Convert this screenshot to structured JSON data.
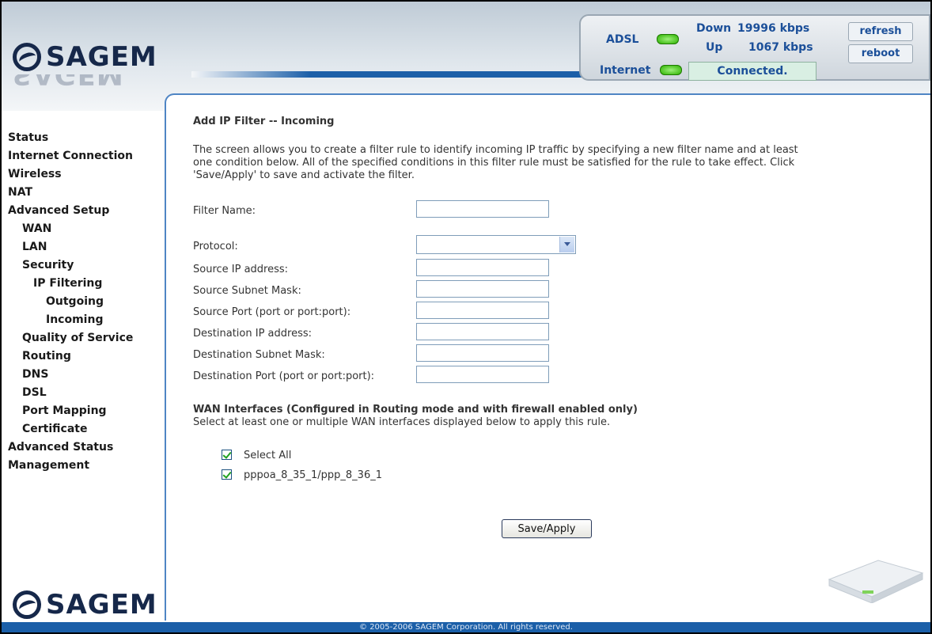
{
  "brand": {
    "name": "SAGEM"
  },
  "status_panel": {
    "adsl_label": "ADSL",
    "internet_label": "Internet",
    "down_label": "Down",
    "up_label": "Up",
    "down_speed": "19996 kbps",
    "up_speed": "1067 kbps",
    "connection_status": "Connected.",
    "refresh_label": "refresh",
    "reboot_label": "reboot",
    "led_color": "#2db200"
  },
  "sidebar": {
    "items": [
      {
        "label": "Status",
        "level": 0
      },
      {
        "label": "Internet Connection",
        "level": 0
      },
      {
        "label": "Wireless",
        "level": 0
      },
      {
        "label": "NAT",
        "level": 0
      },
      {
        "label": "Advanced Setup",
        "level": 0
      },
      {
        "label": "WAN",
        "level": 1
      },
      {
        "label": "LAN",
        "level": 1
      },
      {
        "label": "Security",
        "level": 1
      },
      {
        "label": "IP Filtering",
        "level": 2
      },
      {
        "label": "Outgoing",
        "level": 3
      },
      {
        "label": "Incoming",
        "level": 3
      },
      {
        "label": "Quality of Service",
        "level": 1
      },
      {
        "label": "Routing",
        "level": 1
      },
      {
        "label": "DNS",
        "level": 1
      },
      {
        "label": "DSL",
        "level": 1
      },
      {
        "label": "Port Mapping",
        "level": 1
      },
      {
        "label": "Certificate",
        "level": 1
      },
      {
        "label": "Advanced Status",
        "level": 0
      },
      {
        "label": "Management",
        "level": 0
      }
    ]
  },
  "main": {
    "title": "Add IP Filter -- Incoming",
    "description_lines": [
      "The screen allows you to create a filter rule to identify incoming IP traffic by specifying a new filter name and at least",
      "one condition below. All of the specified conditions in this filter rule must be satisfied for the rule to take effect. Click",
      "'Save/Apply' to save and activate the filter."
    ],
    "fields": {
      "filter_name": {
        "label": "Filter Name:",
        "value": ""
      },
      "protocol": {
        "label": "Protocol:",
        "value": ""
      },
      "src_ip": {
        "label": "Source IP address:",
        "value": ""
      },
      "src_mask": {
        "label": "Source Subnet Mask:",
        "value": ""
      },
      "src_port": {
        "label": "Source Port (port or port:port):",
        "value": ""
      },
      "dst_ip": {
        "label": "Destination IP address:",
        "value": ""
      },
      "dst_mask": {
        "label": "Destination Subnet Mask:",
        "value": ""
      },
      "dst_port": {
        "label": "Destination Port (port or port:port):",
        "value": ""
      }
    },
    "wan": {
      "heading": "WAN Interfaces (Configured in Routing mode and with firewall enabled only)",
      "subtext": "Select at least one or multiple WAN interfaces displayed below to apply this rule.",
      "select_all_label": "Select All",
      "select_all_checked": true,
      "interfaces": [
        {
          "label": "pppoa_8_35_1/ppp_8_36_1",
          "checked": true
        }
      ]
    },
    "save_label": "Save/Apply"
  },
  "footer": {
    "copyright": "© 2005-2006 SAGEM Corporation. All rights reserved."
  },
  "colors": {
    "brand_navy": "#16284a",
    "accent_blue": "#1b5fa8",
    "link_blue": "#1b4f99"
  }
}
